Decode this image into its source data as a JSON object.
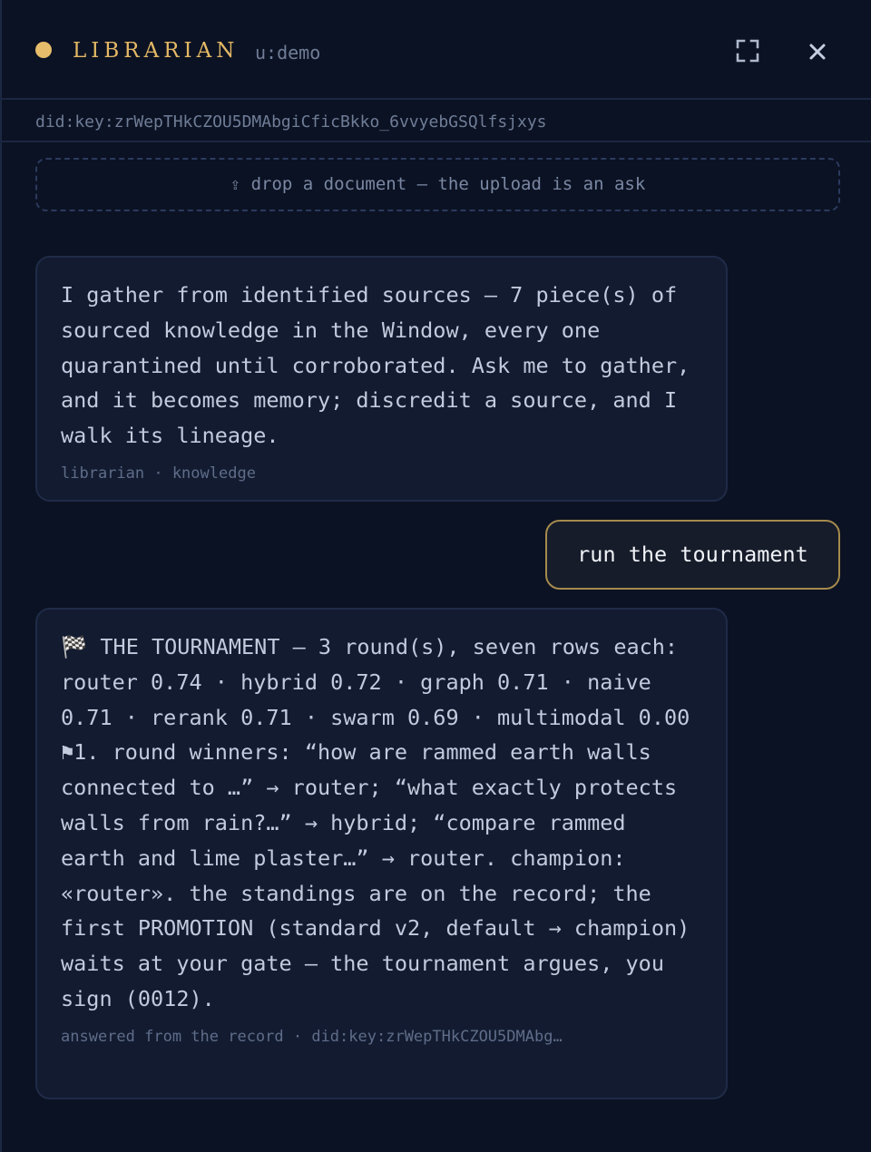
{
  "header": {
    "title": "LIBRARIAN",
    "user": "u:demo",
    "status_color": "#e6bd6a",
    "expand_icon": "expand-icon",
    "close_icon": "close-icon"
  },
  "identity": {
    "did": "did:key:zrWepTHkCZOU5DMAbgiCficBkko_6vvyebGSQlfsjxys"
  },
  "upload": {
    "label": "⇪ drop a document — the upload is an ask"
  },
  "messages": [
    {
      "role": "assistant",
      "text": "I gather from identified sources — 7 piece(s) of sourced knowledge in the Window, every one quarantined until corroborated. Ask me to gather, and it becomes memory; discredit a source, and I walk its lineage.",
      "meta": "librarian · knowledge"
    },
    {
      "role": "user",
      "text": "run the tournament"
    },
    {
      "role": "assistant",
      "text": "🏁 THE TOURNAMENT — 3 round(s), seven rows each: router 0.74 · hybrid 0.72 · graph 0.71 · naive 0.71 · rerank 0.71 · swarm 0.69 · multimodal 0.00 ⚑1. round winners: “how are rammed earth walls connected to …” → router; “what exactly protects walls from rain?…” → hybrid; “compare rammed earth and lime plaster…” → router. champion: «router». the standings are on the record; the first PROMOTION (standard v2, default → champion) waits at your gate — the tournament argues, you sign (0012).",
      "meta": "answered from the record · did:key:zrWepTHkCZOU5DMAbg…"
    }
  ]
}
